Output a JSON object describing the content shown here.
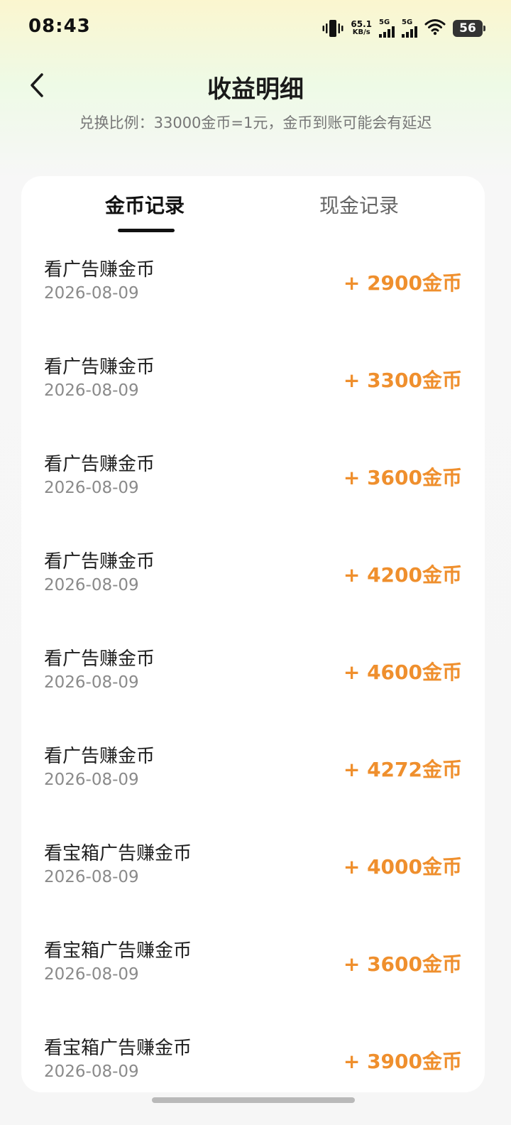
{
  "status_bar": {
    "time": "08:43",
    "net_speed_value": "65.1",
    "net_speed_unit": "KB/s",
    "sim1_label": "5G",
    "sim2_label": "5G",
    "battery_level": "56",
    "icons": [
      "vibrate-icon",
      "signal-icon",
      "signal-icon",
      "wifi-icon",
      "battery-icon"
    ]
  },
  "header": {
    "title": "收益明细",
    "back_icon": "chevron-left-icon",
    "exchange_note": "兑换比例：33000金币=1元，金币到账可能会有延迟"
  },
  "tabs": [
    {
      "label": "金币记录",
      "active": true
    },
    {
      "label": "现金记录",
      "active": false
    }
  ],
  "records": [
    {
      "title": "看广告赚金币",
      "date": "2026-08-09",
      "amount": "+ 2900金币"
    },
    {
      "title": "看广告赚金币",
      "date": "2026-08-09",
      "amount": "+ 3300金币"
    },
    {
      "title": "看广告赚金币",
      "date": "2026-08-09",
      "amount": "+ 3600金币"
    },
    {
      "title": "看广告赚金币",
      "date": "2026-08-09",
      "amount": "+ 4200金币"
    },
    {
      "title": "看广告赚金币",
      "date": "2026-08-09",
      "amount": "+ 4600金币"
    },
    {
      "title": "看广告赚金币",
      "date": "2026-08-09",
      "amount": "+ 4272金币"
    },
    {
      "title": "看宝箱广告赚金币",
      "date": "2026-08-09",
      "amount": "+ 4000金币"
    },
    {
      "title": "看宝箱广告赚金币",
      "date": "2026-08-09",
      "amount": "+ 3600金币"
    },
    {
      "title": "看宝箱广告赚金币",
      "date": "2026-08-09",
      "amount": "+ 3900金币"
    }
  ],
  "colors": {
    "accent_amount": "#ef8f2d",
    "active_tab": "#111111",
    "inactive_tab": "#666666"
  }
}
